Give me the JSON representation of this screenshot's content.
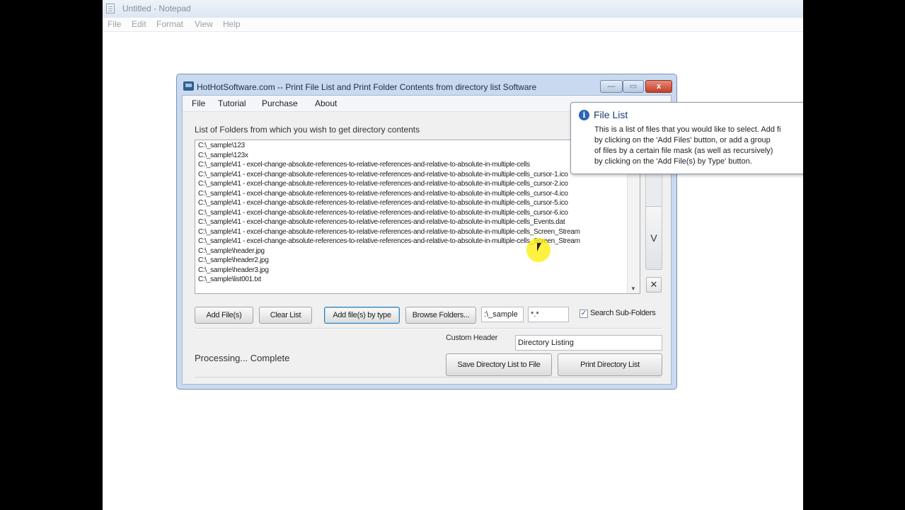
{
  "notepad": {
    "title": "Untitled - Notepad",
    "menu": [
      "File",
      "Edit",
      "Format",
      "View",
      "Help"
    ]
  },
  "window": {
    "title": "HotHotSoftware.com -- Print File List and Print Folder Contents from directory list Software",
    "menu": [
      "File",
      "Tutorial",
      "Purchase",
      "About"
    ],
    "close_glyph": "x",
    "min_glyph": "—",
    "max_glyph": "▭"
  },
  "main": {
    "list_label": "List of Folders from which you wish to get directory contents",
    "items": [
      "C:\\_sample\\123",
      "C:\\_sample\\123x",
      "C:\\_sample\\41 - excel-change-absolute-references-to-relative-references-and-relative-to-absolute-in-multiple-cells",
      "C:\\_sample\\41 - excel-change-absolute-references-to-relative-references-and-relative-to-absolute-in-multiple-cells_cursor-1.ico",
      "C:\\_sample\\41 - excel-change-absolute-references-to-relative-references-and-relative-to-absolute-in-multiple-cells_cursor-2.ico",
      "C:\\_sample\\41 - excel-change-absolute-references-to-relative-references-and-relative-to-absolute-in-multiple-cells_cursor-4.ico",
      "C:\\_sample\\41 - excel-change-absolute-references-to-relative-references-and-relative-to-absolute-in-multiple-cells_cursor-5.ico",
      "C:\\_sample\\41 - excel-change-absolute-references-to-relative-references-and-relative-to-absolute-in-multiple-cells_cursor-6.ico",
      "C:\\_sample\\41 - excel-change-absolute-references-to-relative-references-and-relative-to-absolute-in-multiple-cells_Events.dat",
      "C:\\_sample\\41 - excel-change-absolute-references-to-relative-references-and-relative-to-absolute-in-multiple-cells_Screen_Stream",
      "C:\\_sample\\41 - excel-change-absolute-references-to-relative-references-and-relative-to-absolute-in-multiple-cells_Screen_Stream",
      "C:\\_sample\\header.jpg",
      "C:\\_sample\\header2.jpg",
      "C:\\_sample\\header3.jpg",
      "C:\\_sample\\list001.txt"
    ],
    "scroll_down_glyph": "▼",
    "side_down_glyph": "V",
    "side_remove_glyph": "✕"
  },
  "buttons": {
    "add_files": "Add File(s)",
    "clear_list": "Clear List",
    "add_by_type": "Add file(s) by type",
    "browse": "Browse Folders...",
    "save": "Save Directory List to File",
    "print": "Print Directory List"
  },
  "inputs": {
    "path_value": ":\\_sample",
    "mask_value": "*.*",
    "header_label": "Custom Header",
    "header_value": "Directory Listing"
  },
  "search_subfolders": {
    "label": "Search Sub-Folders",
    "checked": true,
    "check_glyph": "✓"
  },
  "status": "Processing... Complete",
  "tooltip": {
    "title": "File List",
    "icon_glyph": "i",
    "lines": [
      "This is a list of files that you would like to select. Add fi",
      "by clicking on the 'Add Files' button, or add a group",
      "of files by a certain file mask (as well as recursively)",
      "by clicking on the 'Add File(s) by Type' button."
    ]
  }
}
